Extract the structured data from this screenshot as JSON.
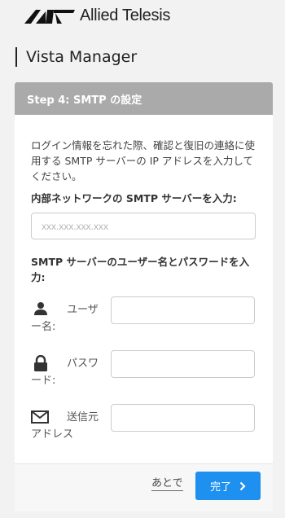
{
  "brand": {
    "logo_text": "Allied Telesis"
  },
  "product": {
    "name": "Vista Manager"
  },
  "step": {
    "title": "Step 4: SMTP の設定"
  },
  "intro": "ログイン情報を忘れた際、確認と復旧の連絡に使用する SMTP サーバーの IP アドレスを入力してください。",
  "smtp": {
    "label": "内部ネットワークの SMTP サーバーを入力:",
    "placeholder": "xxx.xxx.xxx.xxx",
    "value": ""
  },
  "auth": {
    "label": "SMTP サーバーのユーザー名とパスワードを入力:",
    "fields": [
      {
        "label": "ユーザー名:",
        "icon": "user-icon",
        "value": ""
      },
      {
        "label": "パスワード:",
        "icon": "lock-icon",
        "value": ""
      },
      {
        "label": "送信元アドレス",
        "icon": "mail-icon",
        "value": ""
      }
    ]
  },
  "footer": {
    "later_label": "あとで",
    "finish_label": "完了"
  }
}
